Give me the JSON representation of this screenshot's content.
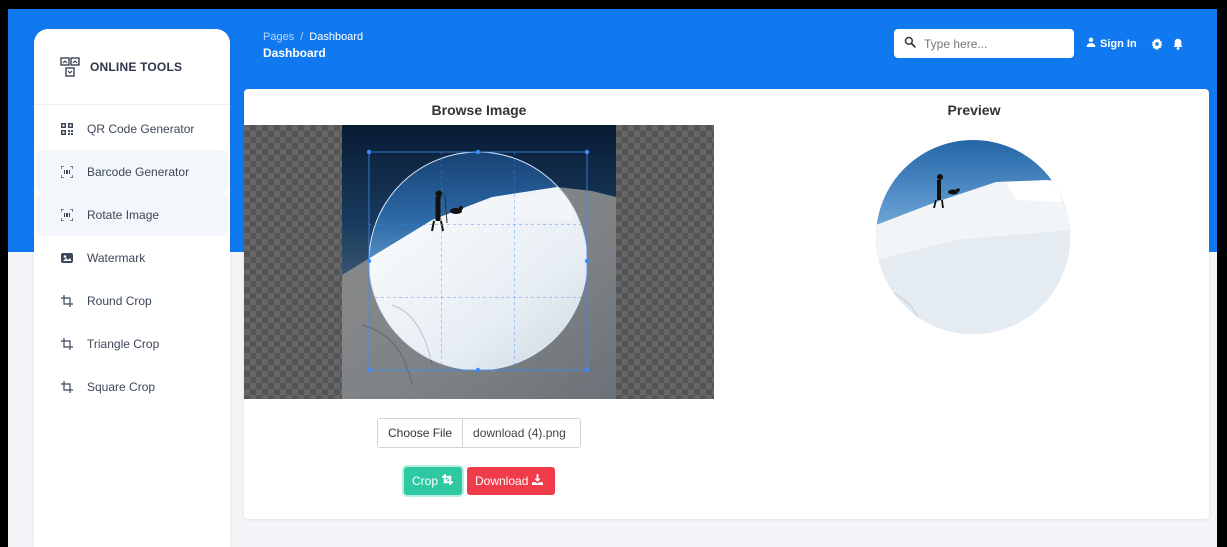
{
  "app": {
    "brand": "ONLINE TOOLS"
  },
  "sidebar": {
    "items": [
      {
        "label": "QR Code Generator",
        "icon": "qr-code-icon"
      },
      {
        "label": "Barcode Generator",
        "icon": "barcode-scan-icon"
      },
      {
        "label": "Rotate Image",
        "icon": "barcode-scan-icon"
      },
      {
        "label": "Watermark",
        "icon": "image-icon"
      },
      {
        "label": "Round Crop",
        "icon": "crop-icon"
      },
      {
        "label": "Triangle Crop",
        "icon": "crop-icon"
      },
      {
        "label": "Square Crop",
        "icon": "crop-icon"
      }
    ]
  },
  "header": {
    "breadcrumb_root": "Pages",
    "breadcrumb_separator": "/",
    "breadcrumb_current": "Dashboard",
    "title": "Dashboard",
    "search_placeholder": "Type here...",
    "signin_label": "Sign In"
  },
  "main": {
    "browse_title": "Browse Image",
    "preview_title": "Preview",
    "file_button_label": "Choose File",
    "file_name": "download (4).png",
    "crop_label": "Crop",
    "download_label": "Download"
  },
  "colors": {
    "header_blue": "#1179f0",
    "crop_button": "#2ec9a2",
    "download_button": "#ef3b4a"
  }
}
